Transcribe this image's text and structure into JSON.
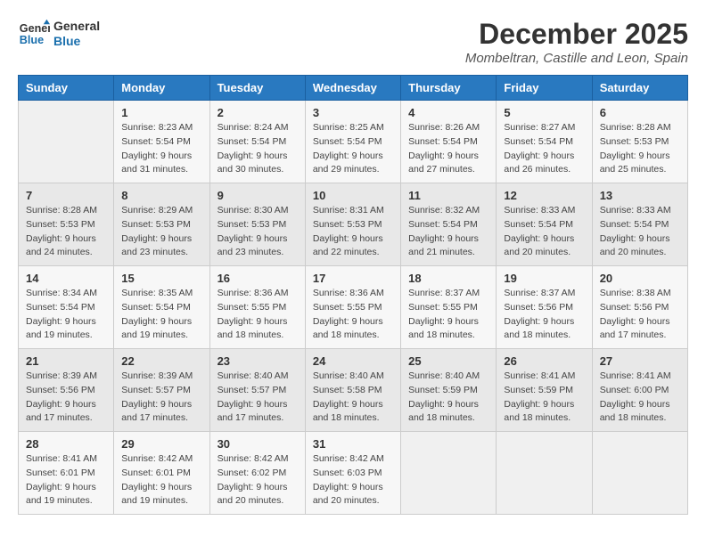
{
  "header": {
    "logo_line1": "General",
    "logo_line2": "Blue",
    "month_year": "December 2025",
    "location": "Mombeltran, Castille and Leon, Spain"
  },
  "weekdays": [
    "Sunday",
    "Monday",
    "Tuesday",
    "Wednesday",
    "Thursday",
    "Friday",
    "Saturday"
  ],
  "weeks": [
    [
      {
        "day": "",
        "info": ""
      },
      {
        "day": "1",
        "info": "Sunrise: 8:23 AM\nSunset: 5:54 PM\nDaylight: 9 hours\nand 31 minutes."
      },
      {
        "day": "2",
        "info": "Sunrise: 8:24 AM\nSunset: 5:54 PM\nDaylight: 9 hours\nand 30 minutes."
      },
      {
        "day": "3",
        "info": "Sunrise: 8:25 AM\nSunset: 5:54 PM\nDaylight: 9 hours\nand 29 minutes."
      },
      {
        "day": "4",
        "info": "Sunrise: 8:26 AM\nSunset: 5:54 PM\nDaylight: 9 hours\nand 27 minutes."
      },
      {
        "day": "5",
        "info": "Sunrise: 8:27 AM\nSunset: 5:54 PM\nDaylight: 9 hours\nand 26 minutes."
      },
      {
        "day": "6",
        "info": "Sunrise: 8:28 AM\nSunset: 5:53 PM\nDaylight: 9 hours\nand 25 minutes."
      }
    ],
    [
      {
        "day": "7",
        "info": "Sunrise: 8:28 AM\nSunset: 5:53 PM\nDaylight: 9 hours\nand 24 minutes."
      },
      {
        "day": "8",
        "info": "Sunrise: 8:29 AM\nSunset: 5:53 PM\nDaylight: 9 hours\nand 23 minutes."
      },
      {
        "day": "9",
        "info": "Sunrise: 8:30 AM\nSunset: 5:53 PM\nDaylight: 9 hours\nand 23 minutes."
      },
      {
        "day": "10",
        "info": "Sunrise: 8:31 AM\nSunset: 5:53 PM\nDaylight: 9 hours\nand 22 minutes."
      },
      {
        "day": "11",
        "info": "Sunrise: 8:32 AM\nSunset: 5:54 PM\nDaylight: 9 hours\nand 21 minutes."
      },
      {
        "day": "12",
        "info": "Sunrise: 8:33 AM\nSunset: 5:54 PM\nDaylight: 9 hours\nand 20 minutes."
      },
      {
        "day": "13",
        "info": "Sunrise: 8:33 AM\nSunset: 5:54 PM\nDaylight: 9 hours\nand 20 minutes."
      }
    ],
    [
      {
        "day": "14",
        "info": "Sunrise: 8:34 AM\nSunset: 5:54 PM\nDaylight: 9 hours\nand 19 minutes."
      },
      {
        "day": "15",
        "info": "Sunrise: 8:35 AM\nSunset: 5:54 PM\nDaylight: 9 hours\nand 19 minutes."
      },
      {
        "day": "16",
        "info": "Sunrise: 8:36 AM\nSunset: 5:55 PM\nDaylight: 9 hours\nand 18 minutes."
      },
      {
        "day": "17",
        "info": "Sunrise: 8:36 AM\nSunset: 5:55 PM\nDaylight: 9 hours\nand 18 minutes."
      },
      {
        "day": "18",
        "info": "Sunrise: 8:37 AM\nSunset: 5:55 PM\nDaylight: 9 hours\nand 18 minutes."
      },
      {
        "day": "19",
        "info": "Sunrise: 8:37 AM\nSunset: 5:56 PM\nDaylight: 9 hours\nand 18 minutes."
      },
      {
        "day": "20",
        "info": "Sunrise: 8:38 AM\nSunset: 5:56 PM\nDaylight: 9 hours\nand 17 minutes."
      }
    ],
    [
      {
        "day": "21",
        "info": "Sunrise: 8:39 AM\nSunset: 5:56 PM\nDaylight: 9 hours\nand 17 minutes."
      },
      {
        "day": "22",
        "info": "Sunrise: 8:39 AM\nSunset: 5:57 PM\nDaylight: 9 hours\nand 17 minutes."
      },
      {
        "day": "23",
        "info": "Sunrise: 8:40 AM\nSunset: 5:57 PM\nDaylight: 9 hours\nand 17 minutes."
      },
      {
        "day": "24",
        "info": "Sunrise: 8:40 AM\nSunset: 5:58 PM\nDaylight: 9 hours\nand 18 minutes."
      },
      {
        "day": "25",
        "info": "Sunrise: 8:40 AM\nSunset: 5:59 PM\nDaylight: 9 hours\nand 18 minutes."
      },
      {
        "day": "26",
        "info": "Sunrise: 8:41 AM\nSunset: 5:59 PM\nDaylight: 9 hours\nand 18 minutes."
      },
      {
        "day": "27",
        "info": "Sunrise: 8:41 AM\nSunset: 6:00 PM\nDaylight: 9 hours\nand 18 minutes."
      }
    ],
    [
      {
        "day": "28",
        "info": "Sunrise: 8:41 AM\nSunset: 6:01 PM\nDaylight: 9 hours\nand 19 minutes."
      },
      {
        "day": "29",
        "info": "Sunrise: 8:42 AM\nSunset: 6:01 PM\nDaylight: 9 hours\nand 19 minutes."
      },
      {
        "day": "30",
        "info": "Sunrise: 8:42 AM\nSunset: 6:02 PM\nDaylight: 9 hours\nand 20 minutes."
      },
      {
        "day": "31",
        "info": "Sunrise: 8:42 AM\nSunset: 6:03 PM\nDaylight: 9 hours\nand 20 minutes."
      },
      {
        "day": "",
        "info": ""
      },
      {
        "day": "",
        "info": ""
      },
      {
        "day": "",
        "info": ""
      }
    ]
  ]
}
